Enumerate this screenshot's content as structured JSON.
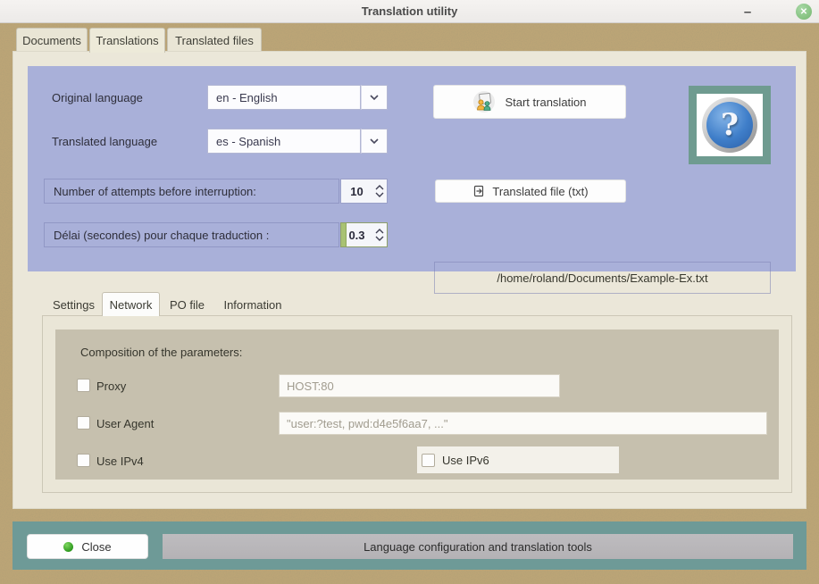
{
  "window": {
    "title": "Translation utility",
    "minimize_glyph": "–",
    "close_glyph": "✕"
  },
  "main_tabs": [
    {
      "label": "Documents"
    },
    {
      "label": "Translations"
    },
    {
      "label": "Translated files"
    }
  ],
  "translation_panel": {
    "original_language_label": "Original language",
    "original_language_value": "en - English",
    "translated_language_label": "Translated language",
    "translated_language_value": "es - Spanish",
    "attempts_label": "Number of attempts before interruption:",
    "attempts_value": "10",
    "delay_label": "Délai (secondes) pour chaque traduction :",
    "delay_value": "0.3",
    "start_button_label": "Start translation",
    "translated_file_button_label": "Translated file (txt)",
    "output_path": "/home/roland/Documents/Example-Ex.txt",
    "help_glyph": "?"
  },
  "sub_tabs": [
    {
      "label": "Settings"
    },
    {
      "label": "Network"
    },
    {
      "label": "PO file"
    },
    {
      "label": "Information"
    }
  ],
  "network": {
    "section_title": "Composition of the parameters:",
    "proxy_label": "Proxy",
    "proxy_placeholder": "HOST:80",
    "user_agent_label": "User Agent",
    "user_agent_placeholder": "\"user:?test, pwd:d4e5f6aa7, ...\"",
    "ipv4_label": "Use IPv4",
    "ipv6_label": "Use IPv6"
  },
  "footer": {
    "close_button_label": "Close",
    "info_bar_label": "Language configuration and translation tools"
  },
  "colors": {
    "panel_blue": "#a9b0d9",
    "panel_cream": "#ebe7d9",
    "panel_gray_beige": "#c6c0ae",
    "footer_teal": "#6e9a97",
    "sand": "#c7aa76",
    "spin_progress_green": "#a9c273",
    "close_dot_green": "#2f9a1f"
  }
}
